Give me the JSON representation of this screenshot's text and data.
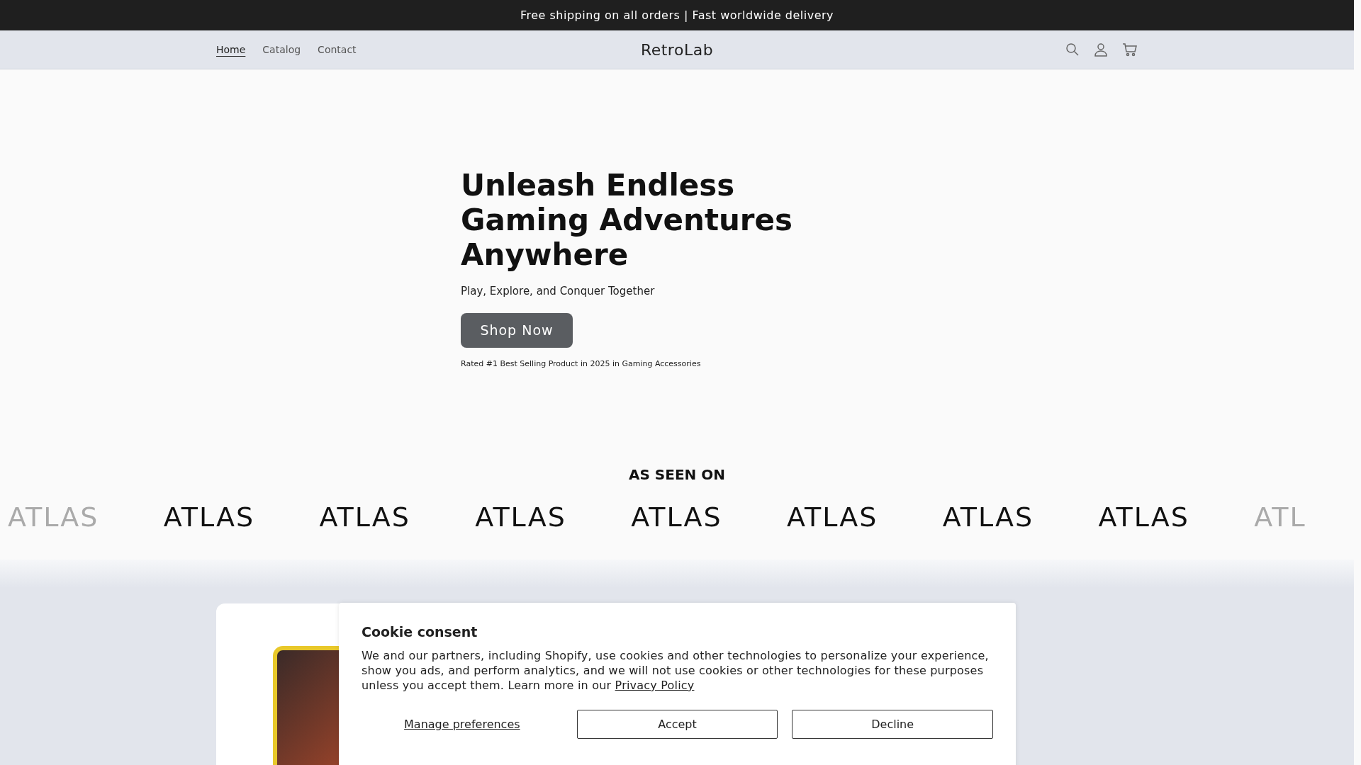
{
  "announcement": "Free shipping on all orders | Fast worldwide delivery",
  "header": {
    "nav": [
      {
        "label": "Home",
        "selected": true
      },
      {
        "label": "Catalog",
        "selected": false
      },
      {
        "label": "Contact",
        "selected": false
      }
    ],
    "logo": "RetroLab"
  },
  "hero": {
    "title": "Unleash Endless Gaming Adventures Anywhere",
    "subtitle": "Play, Explore, and Conquer Together",
    "button": "Shop Now",
    "note": "Rated #1 Best Selling Product in 2025 in Gaming Accessories"
  },
  "press": {
    "heading": "AS SEEN ON",
    "logos": [
      "ATLAS",
      "ATLAS",
      "ATLAS",
      "ATLAS",
      "ATLAS",
      "ATLAS",
      "ATLAS",
      "ATLAS",
      "ATL"
    ]
  },
  "cookie_banner": {
    "title": "Cookie consent",
    "text": "We and our partners, including Shopify, use cookies and other technologies to personalize your experience, show you ads, and perform analytics, and we will not use cookies or other technologies for these purposes unless you accept them. Learn more in our",
    "link": "Privacy Policy",
    "manage": "Manage preferences",
    "accept": "Accept",
    "decline": "Decline"
  }
}
